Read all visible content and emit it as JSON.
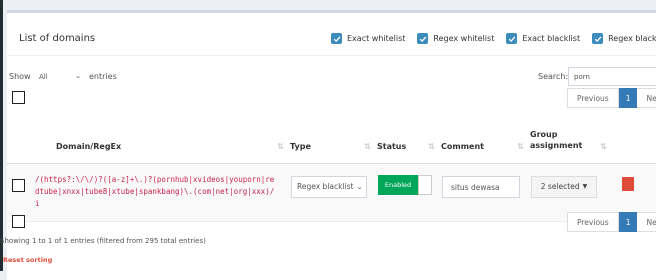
{
  "title": "List of domains",
  "filters": [
    {
      "label": "Exact whitelist",
      "checked": true
    },
    {
      "label": "Regex whitelist",
      "checked": true
    },
    {
      "label": "Exact blacklist",
      "checked": true
    },
    {
      "label": "Regex blackli",
      "checked": true
    }
  ],
  "length": {
    "show_label": "Show",
    "value": "All",
    "entries_label": "entries"
  },
  "search": {
    "label": "Search:",
    "value": "porn"
  },
  "pagination": {
    "previous": "Previous",
    "current": "1",
    "next": "Ne"
  },
  "columns": {
    "domain": "Domain/RegEx",
    "type": "Type",
    "status": "Status",
    "comment": "Comment",
    "group": "Group assignment"
  },
  "rows": [
    {
      "domain": "/(https?:\\/\\/)?([a-z]+\\.)?(pornhub|xvideos|youporn|redtube|xnxx|tube8|xtube|spankbang)\\.(com|net|org|xxx)/i",
      "type": "Regex blacklist",
      "status": "Enabled",
      "comment": "situs dewasa",
      "group": "2 selected"
    }
  ],
  "info": "Showing 1 to 1 of 1 entries (filtered from 295 total entries)",
  "reset": "Reset sorting",
  "colors": {
    "accent": "#3c8dbc",
    "enabled": "#00a65a",
    "danger": "#dd4b39",
    "regex": "#c7254e"
  }
}
